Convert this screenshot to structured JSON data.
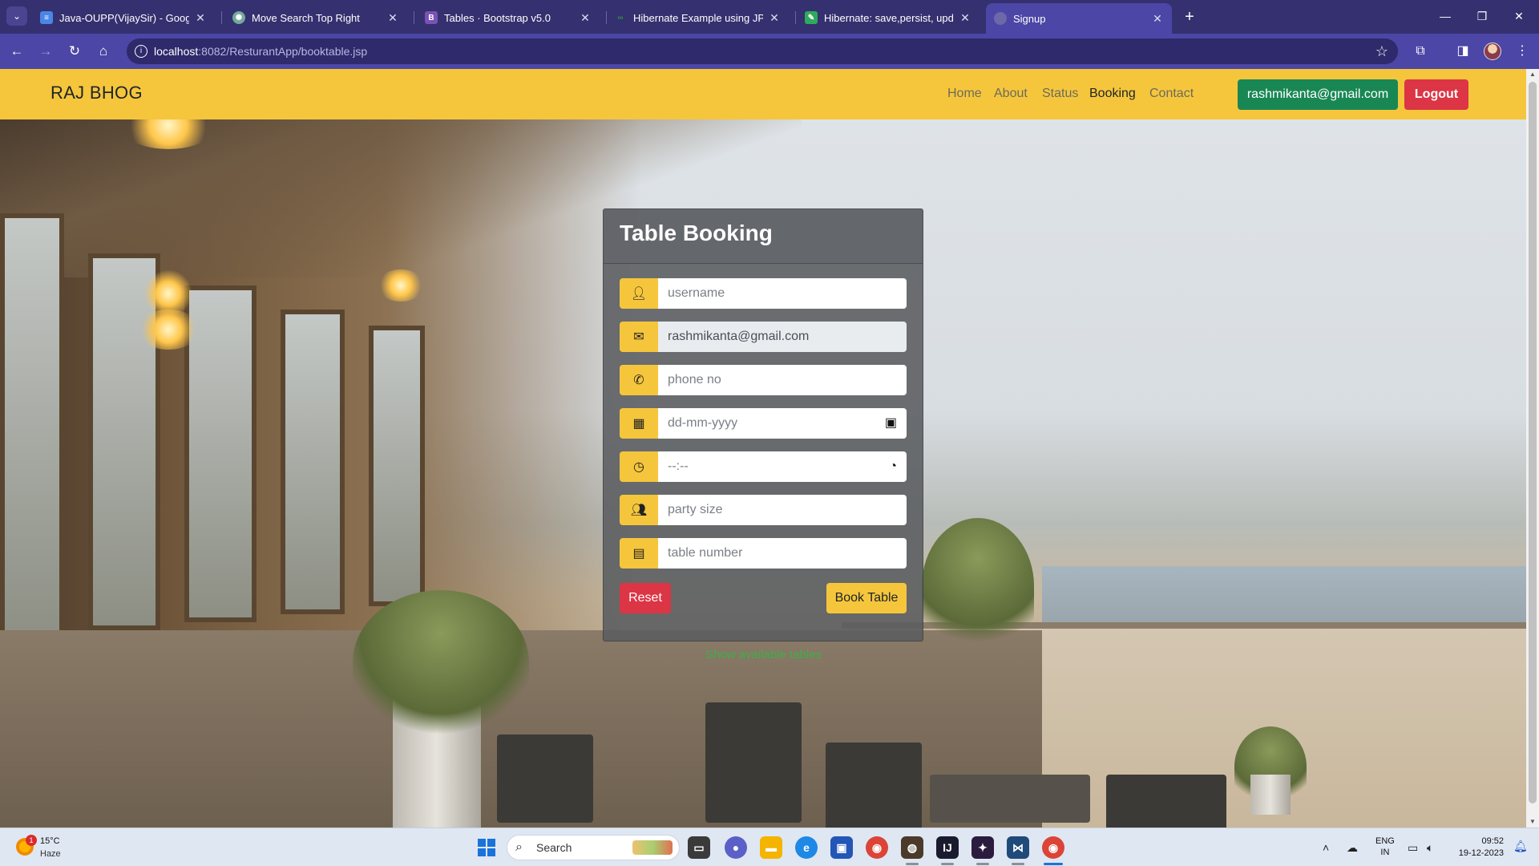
{
  "browser": {
    "tabs": [
      {
        "title": "Java-OUPP(VijaySir) - Google D",
        "icon": "google-docs-icon",
        "color": "#4a86e8"
      },
      {
        "title": "Move Search Top Right",
        "icon": "chatgpt-icon",
        "color": "#74aa9c"
      },
      {
        "title": "Tables · Bootstrap v5.0",
        "icon": "bootstrap-icon",
        "color": "#7952b3"
      },
      {
        "title": "Hibernate Example using JPA ar",
        "icon": "gfg-icon",
        "color": "#2f8d46"
      },
      {
        "title": "Hibernate: save,persist, update,",
        "icon": "site-icon",
        "color": "#2eaa5c"
      },
      {
        "title": "Signup",
        "icon": "globe-icon",
        "color": "#8886b8"
      }
    ],
    "url_host": "localhost",
    "url_path": ":8082/ResturantApp/booktable.jsp"
  },
  "navbar": {
    "brand": "RAJ BHOG",
    "links": [
      "Home",
      "About",
      "Status",
      "Booking",
      "Contact"
    ],
    "active_link": "Booking",
    "user_email": "rashmikanta@gmail.com",
    "logout_label": "Logout"
  },
  "booking": {
    "title": "Table Booking",
    "fields": [
      {
        "name": "username",
        "placeholder": "username",
        "value": "",
        "icon": "user-icon"
      },
      {
        "name": "email",
        "placeholder": "",
        "value": "rashmikanta@gmail.com",
        "icon": "envelope-icon"
      },
      {
        "name": "phone",
        "placeholder": "phone no",
        "value": "",
        "icon": "phone-icon"
      },
      {
        "name": "date",
        "placeholder": "dd-mm-yyyy",
        "value": "",
        "icon": "calendar-icon"
      },
      {
        "name": "time",
        "placeholder": "--:--",
        "value": "",
        "icon": "clock-icon"
      },
      {
        "name": "party_size",
        "placeholder": "party size",
        "value": "",
        "icon": "users-icon"
      },
      {
        "name": "table_number",
        "placeholder": "table number",
        "value": "",
        "icon": "table-icon"
      }
    ],
    "reset_label": "Reset",
    "submit_label": "Book Table",
    "available_link": "Show available tables"
  },
  "taskbar": {
    "weather_temp": "15°C",
    "weather_desc": "Haze",
    "weather_badge": "1",
    "search_label": "Search",
    "lang_line1": "ENG",
    "lang_line2": "IN",
    "time": "09:52",
    "date": "19-12-2023"
  }
}
